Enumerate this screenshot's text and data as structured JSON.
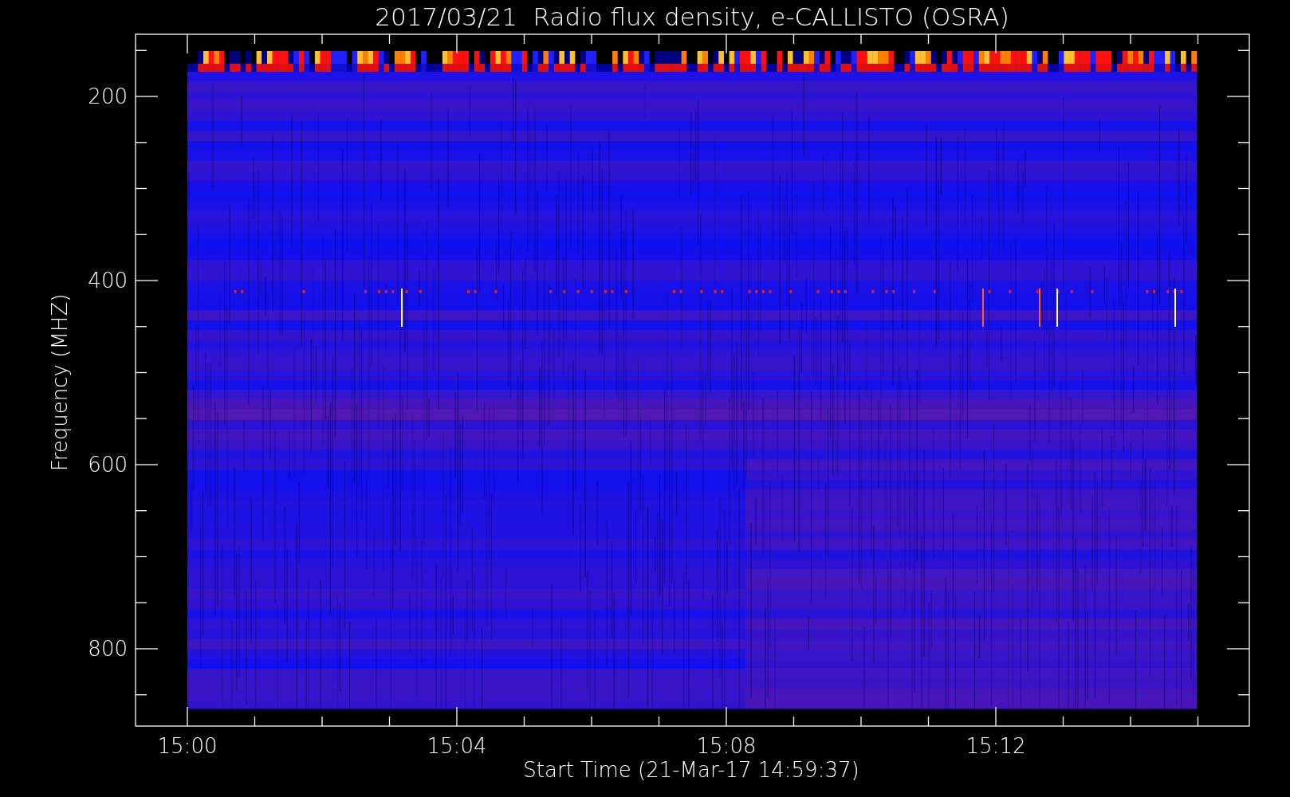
{
  "title": "2017/03/21  Radio flux density, e-CALLISTO (OSRA)",
  "x_axis": {
    "label": "Start Time (21-Mar-17 14:59:37)",
    "ticks": [
      "15:00",
      "15:04",
      "15:08",
      "15:12"
    ]
  },
  "y_axis": {
    "label": "Frequency (MHZ)",
    "ticks": [
      "200",
      "400",
      "600",
      "800"
    ]
  }
}
